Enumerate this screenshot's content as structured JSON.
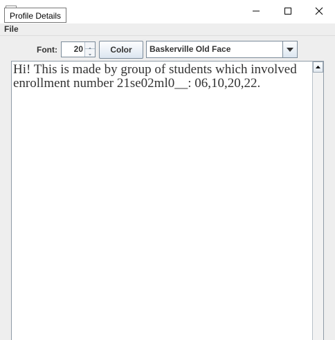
{
  "window": {
    "title": "Profile Details",
    "controls": {
      "minimize_icon": "minimize-icon",
      "maximize_icon": "maximize-icon",
      "close_icon": "close-icon"
    }
  },
  "menu": {
    "items": [
      {
        "label": "File"
      }
    ]
  },
  "toolbar": {
    "font_label": "Font:",
    "font_size": "20",
    "color_label": "Color",
    "font_family": "Baskerville Old Face"
  },
  "editor": {
    "text": "Hi! This is made by group of students which involved enrollment number 21se02ml0__: 06,10,20,22."
  }
}
